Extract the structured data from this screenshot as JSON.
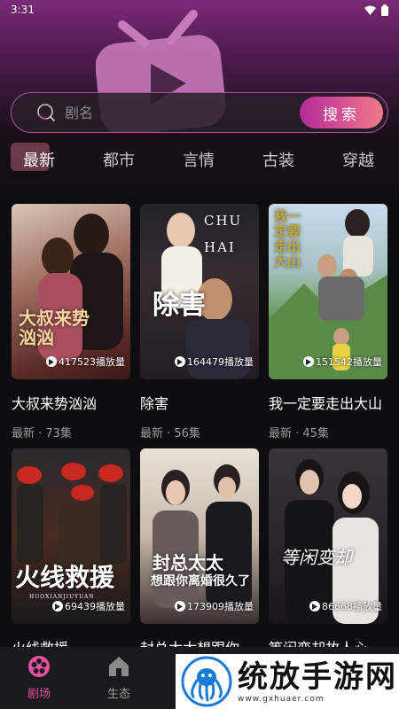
{
  "status_bar": {
    "time": "3:31"
  },
  "search": {
    "placeholder": "剧名",
    "button_label": "搜索"
  },
  "tabs": [
    {
      "label": "最新",
      "active": true
    },
    {
      "label": "都市"
    },
    {
      "label": "言情"
    },
    {
      "label": "古装"
    },
    {
      "label": "穿越"
    }
  ],
  "dramas": [
    {
      "title": "大叔来势汹汹",
      "meta": "最新 · 73集",
      "plays": "417523播放量",
      "poster_text": "大叔来势汹汹"
    },
    {
      "title": "除害",
      "meta": "最新 · 56集",
      "plays": "164479播放量",
      "poster_text": "除害",
      "poster_text2": "CHU HAI"
    },
    {
      "title": "我一定要走出大山",
      "meta": "最新 · 45集",
      "plays": "151542播放量",
      "poster_text": "我一定要走出大山"
    },
    {
      "title": "火线救援",
      "meta": "",
      "plays": "69439播放量",
      "poster_text": "火线救援",
      "poster_sub": "HUOXIANJIUYUAN"
    },
    {
      "title": "封总太太想跟你",
      "meta": "",
      "plays": "173909播放量",
      "poster_text": "封总太太",
      "poster_sub": "想跟你离婚很久了"
    },
    {
      "title": "等闲变却故人心",
      "meta": "",
      "plays": "86668播放量",
      "poster_text": "等闲变却"
    }
  ],
  "bottom_nav": [
    {
      "label": "剧场",
      "icon": "film-reel-icon",
      "active": true
    },
    {
      "label": "生态",
      "icon": "home-icon"
    }
  ],
  "ad": {
    "text": "统放手游网",
    "url": "www.gxhuaer.com"
  },
  "colors": {
    "accent": "#e94ea6",
    "search_border": "#b04aa8",
    "button_start": "#b52a9a",
    "button_end": "#f07a8a"
  }
}
